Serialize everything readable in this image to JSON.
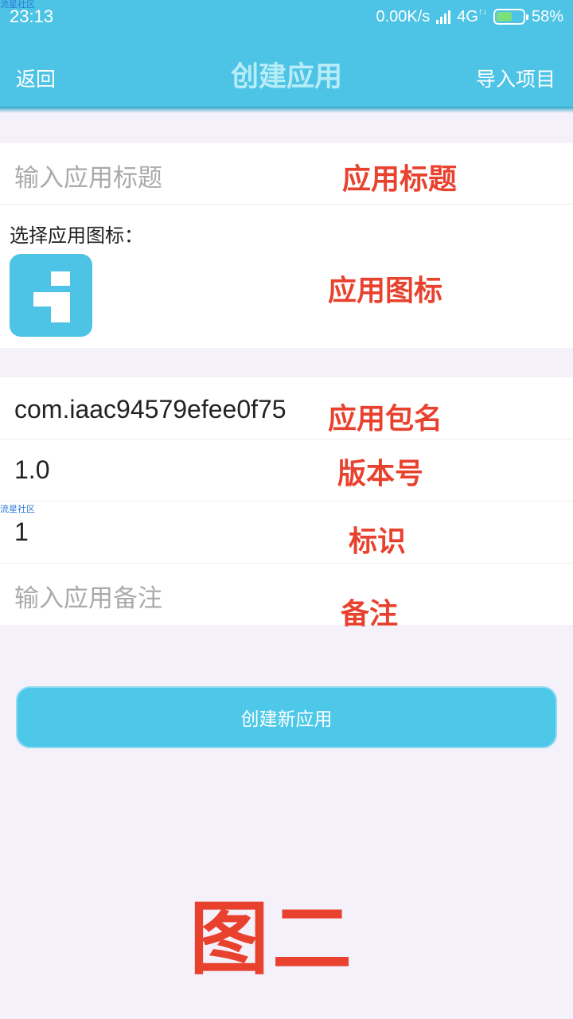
{
  "status_bar": {
    "time": "23:13",
    "network_speed": "0.00K/s",
    "network_type": "4G",
    "battery": "58%",
    "battery_level": 0.58,
    "watermark": "流星社区"
  },
  "app_bar": {
    "back_label": "返回",
    "title": "创建应用",
    "import_label": "导入项目"
  },
  "form": {
    "title_placeholder": "输入应用标题",
    "icon_label": "选择应用图标：",
    "package_name": "com.iaac94579efee0f75",
    "version": "1.0",
    "identifier": "1",
    "note_placeholder": "输入应用备注",
    "watermark": "流星社区"
  },
  "annotations": {
    "title": "应用标题",
    "icon": "应用图标",
    "package": "应用包名",
    "version": "版本号",
    "identifier": "标识",
    "note": "备注",
    "figure": "图二"
  },
  "create_button_label": "创建新应用",
  "colors": {
    "accent": "#4dc4e6",
    "annotation": "#e8412e",
    "background": "#f5f1fb"
  },
  "icons": {
    "app_icon": "info-icon",
    "signal": "signal-icon",
    "battery": "battery-charging-icon"
  }
}
